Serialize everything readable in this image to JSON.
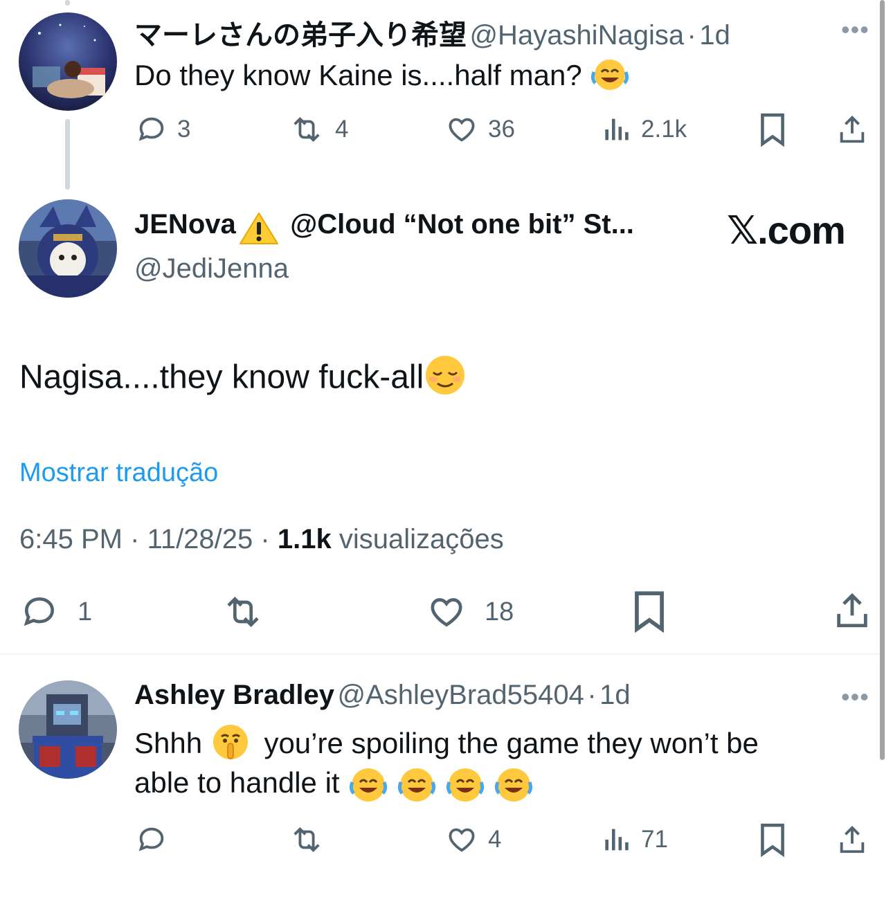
{
  "tweet1": {
    "display_name": "マーレさんの弟子入り希望",
    "handle": "@HayashiNagisa",
    "time": "1d",
    "text": "Do they know Kaine is....half man?",
    "emoji": "😂",
    "replies": "3",
    "reposts": "4",
    "likes": "36",
    "views": "2.1k",
    "more": "•••"
  },
  "main_tweet": {
    "display_name": "JENova",
    "name_suffix": "@Cloud “Not one bit” St...",
    "warning_emoji": "⚠️",
    "handle": "@JediJenna",
    "site_logo": "𝕏.com",
    "text": "Nagisa....they know fuck-all",
    "emoji": "😌",
    "translate_link": "Mostrar tradução",
    "time": "6:45 PM",
    "date": "11/28/25",
    "views_count": "1.1k",
    "views_label": "visualizações",
    "replies": "1",
    "likes": "18"
  },
  "tweet3": {
    "display_name": "Ashley Bradley",
    "handle": "@AshleyBrad55404",
    "time": "1d",
    "text_part1": "Shhh",
    "emoji_shush": "🤫",
    "text_part2": "you’re spoiling the game they won’t be",
    "text_line2": "able to handle it",
    "emojis_laugh": "😂 😂 😂 😂",
    "likes": "4",
    "views": "71",
    "more": "•••"
  },
  "separator": "·",
  "colors": {
    "text_primary": "#0f1419",
    "text_secondary": "#536471",
    "link": "#1d9bf0",
    "divider": "#eff3f4",
    "thread_line": "#cfd9de"
  },
  "icons": [
    "reply-icon",
    "repost-icon",
    "like-icon",
    "views-icon",
    "bookmark-icon",
    "share-icon",
    "more-icon"
  ]
}
